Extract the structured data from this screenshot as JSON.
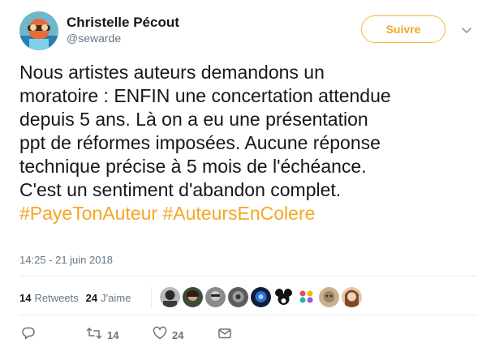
{
  "user": {
    "display_name": "Christelle Pécout",
    "handle": "@sewarde",
    "avatar": "user-avatar"
  },
  "follow_button": {
    "label": "Suivre",
    "color": "#f5a623"
  },
  "tweet": {
    "lines": [
      "Nous artistes auteurs demandons un",
      "moratoire : ENFIN une concertation attendue",
      "depuis 5 ans. Là on a eu une présentation",
      "ppt de réformes imposées. Aucune réponse",
      "technique précise à 5 mois de l'échéance.",
      "C'est un sentiment d'abandon complet."
    ],
    "hashtags": [
      "#PayeTonAuteur",
      "#AuteursEnColere"
    ],
    "timestamp": "14:25 - 21 juin 2018"
  },
  "stats": {
    "retweets_count": "14",
    "retweets_label": "Retweets",
    "likes_count": "24",
    "likes_label": "J'aime"
  },
  "likers": [
    {
      "name": "liker-1"
    },
    {
      "name": "liker-2"
    },
    {
      "name": "liker-3"
    },
    {
      "name": "liker-4"
    },
    {
      "name": "liker-5"
    },
    {
      "name": "liker-6"
    },
    {
      "name": "liker-7"
    },
    {
      "name": "liker-8"
    },
    {
      "name": "liker-9"
    }
  ],
  "actions": {
    "reply_icon": "reply-icon",
    "retweet_icon": "retweet-icon",
    "retweet_count": "14",
    "like_icon": "heart-icon",
    "like_count": "24",
    "dm_icon": "envelope-icon"
  },
  "colors": {
    "accent": "#f5a623",
    "text": "#14171a",
    "muted": "#657786",
    "divider": "#e6ecf0"
  }
}
